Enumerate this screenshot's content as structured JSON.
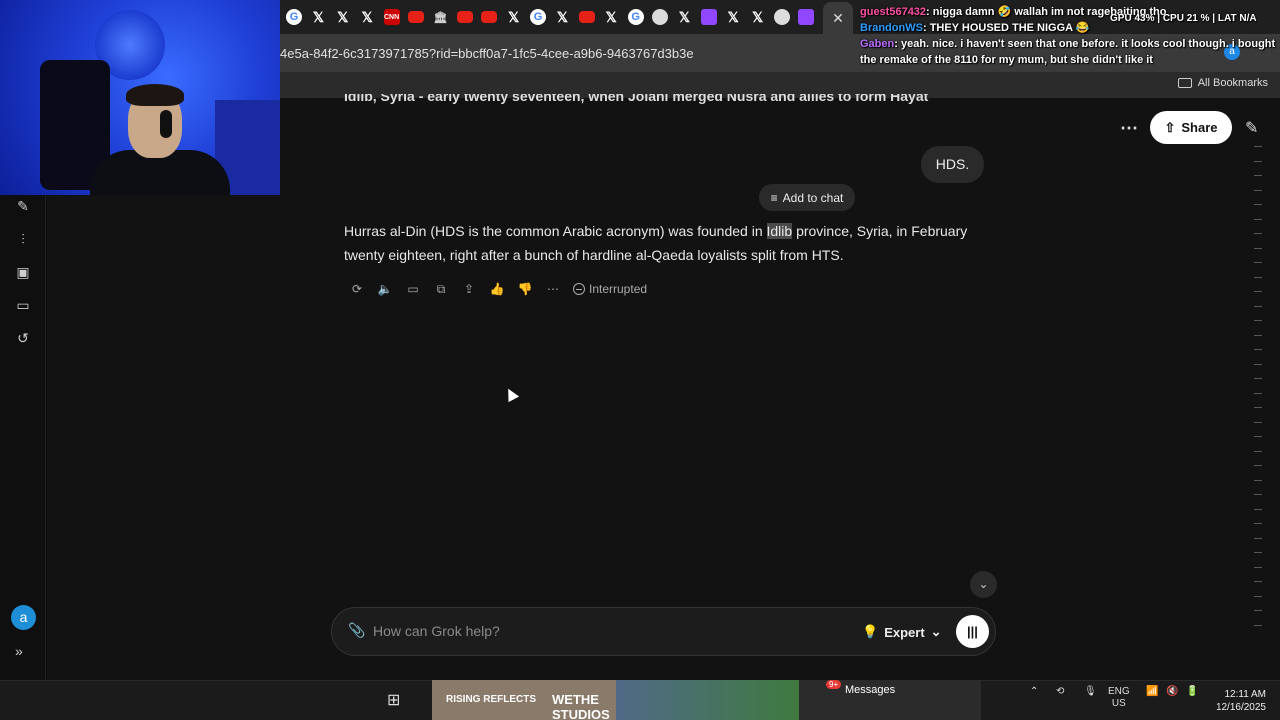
{
  "browser": {
    "url": "4e5a-84f2-6c3173971785?rid=bbcff0a7-1fc5-4cee-a9b6-9463767d3b3e",
    "all_bookmarks": "All Bookmarks",
    "profile_initial": "a",
    "tabs": [
      {
        "icon": "g",
        "label": "G"
      },
      {
        "icon": "x",
        "label": "𝕏"
      },
      {
        "icon": "x",
        "label": "𝕏"
      },
      {
        "icon": "x",
        "label": "𝕏"
      },
      {
        "icon": "cnn",
        "label": "CNN"
      },
      {
        "icon": "yt",
        "label": ""
      },
      {
        "icon": "bank",
        "label": "🏛"
      },
      {
        "icon": "yt",
        "label": ""
      },
      {
        "icon": "yt",
        "label": ""
      },
      {
        "icon": "x",
        "label": "𝕏"
      },
      {
        "icon": "g",
        "label": "G"
      },
      {
        "icon": "x",
        "label": "𝕏"
      },
      {
        "icon": "yt",
        "label": ""
      },
      {
        "icon": "x",
        "label": "𝕏"
      },
      {
        "icon": "g",
        "label": "G"
      },
      {
        "icon": "gh",
        "label": ""
      },
      {
        "icon": "x",
        "label": "𝕏"
      },
      {
        "icon": "tw",
        "label": ""
      },
      {
        "icon": "x",
        "label": "𝕏"
      },
      {
        "icon": "x",
        "label": "𝕏"
      },
      {
        "icon": "gh",
        "label": ""
      },
      {
        "icon": "tw",
        "label": ""
      }
    ],
    "active_tab_close": "✕"
  },
  "stream_overlay": {
    "chat": [
      {
        "user": "guest567432",
        "message": "nigga damn 🤣 wallah im not ragebaiting tho"
      },
      {
        "user": "BrandonWS",
        "message": "THEY HOUSED THE NIGGA 😂"
      },
      {
        "user": "Gaben",
        "message": "yeah. nice. i haven't seen that one before. it looks cool though. i bought the remake of the 8110 for my mum, but she didn't like it"
      }
    ],
    "stats": {
      "gpu_label": "GPU",
      "gpu": "43%",
      "cpu_label": "CPU",
      "cpu": "21 %",
      "lat_label": "LAT",
      "lat": "N/A"
    }
  },
  "grok": {
    "previous_text_cut": "Idlib, Syria - early twenty seventeen, when Jolani merged Nusra and allies to form Hayat",
    "share_label": "Share",
    "user_message": "HDS.",
    "add_to_chat": "Add to chat",
    "answer_before": "Hurras al-Din (HDS is the common Arabic acronym) was founded in ",
    "answer_highlight": "Idlib",
    "answer_after": " province, Syria, in February twenty eighteen, right after a bunch of hardline al-Qaeda loyalists split from HTS.",
    "status": "Interrupted",
    "input_placeholder": "How can Grok help?",
    "mode": "Expert",
    "sidebar_avatar": "a"
  },
  "taskbar": {
    "thumb1_left": "RISING REFLECTS",
    "thumb1_right": "WETHE STUDIOS",
    "messages_label": "Messages",
    "messages_badge": "9+",
    "lang_1": "ENG",
    "lang_2": "US",
    "time": "12:11 AM",
    "date": "12/16/2025"
  }
}
